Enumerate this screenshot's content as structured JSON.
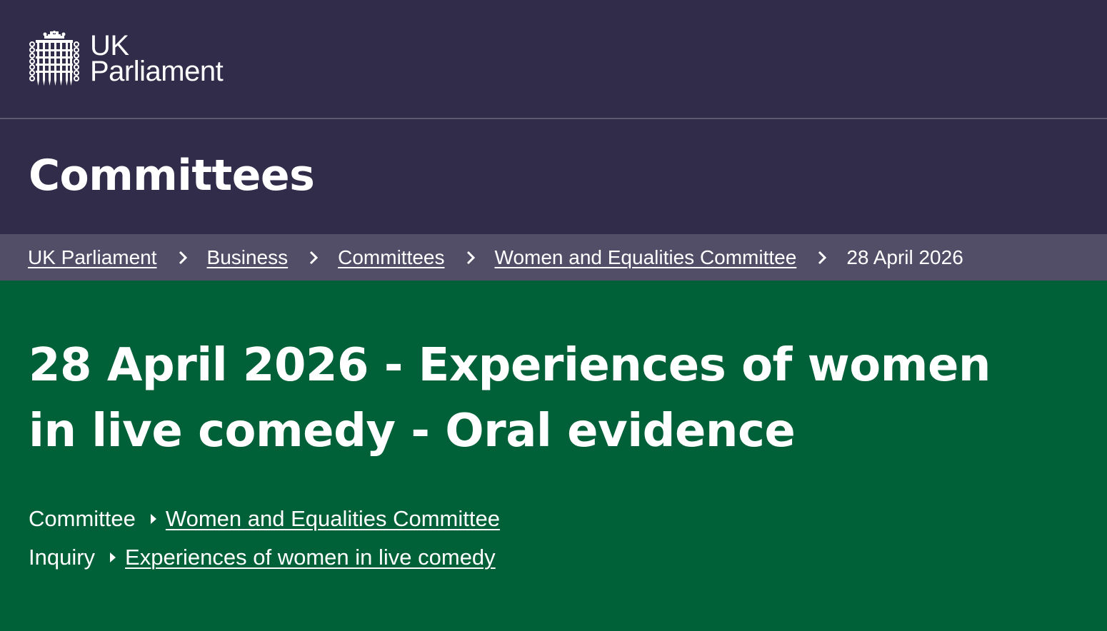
{
  "header": {
    "logo_line1": "UK",
    "logo_line2": "Parliament",
    "logo_icon": "portcullis-icon"
  },
  "section": {
    "title": "Committees"
  },
  "breadcrumb": {
    "items": [
      {
        "label": "UK Parliament"
      },
      {
        "label": "Business"
      },
      {
        "label": "Committees"
      },
      {
        "label": "Women and Equalities Committee"
      }
    ],
    "current": "28 April 2026",
    "separator_icon": "chevron-right-icon"
  },
  "page": {
    "title_line1": "28 April 2026 - Experiences of women",
    "title_line2": "in live comedy - Oral evidence",
    "meta": {
      "committee_label": "Committee",
      "committee_value": "Women and Equalities Committee",
      "inquiry_label": "Inquiry",
      "inquiry_value": "Experiences of women in live comedy",
      "arrow_icon": "triangle-right-icon"
    }
  },
  "colors": {
    "header_bg": "#312c49",
    "breadcrumb_bg": "#524e67",
    "hero_bg": "#006139",
    "text": "#ffffff"
  }
}
